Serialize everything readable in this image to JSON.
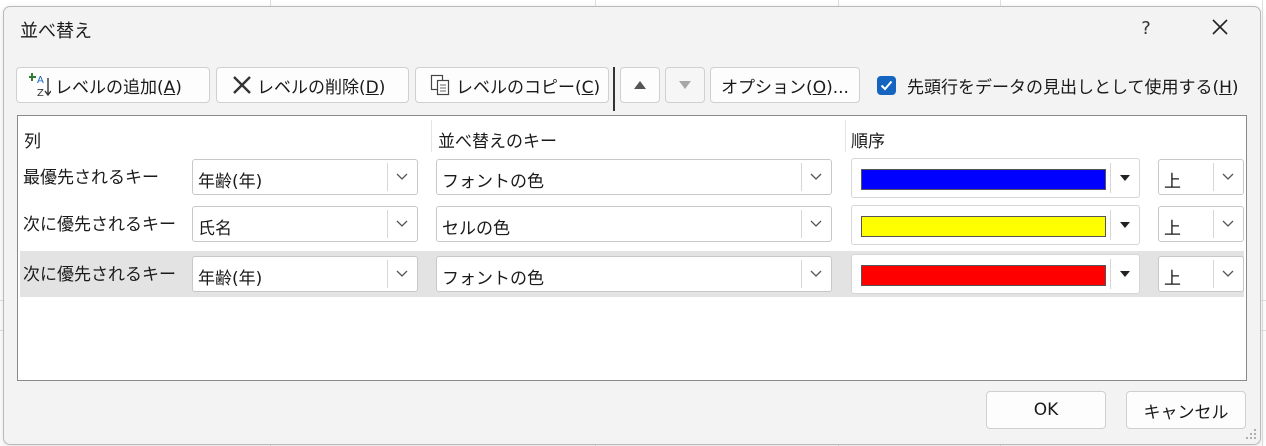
{
  "dialog": {
    "title": "並べ替え",
    "help_label": "?"
  },
  "toolbar": {
    "add_level": {
      "label": "レベルの追加(",
      "key": "A",
      "suffix": ")"
    },
    "delete_level": {
      "label": "レベルの削除(",
      "key": "D",
      "suffix": ")"
    },
    "copy_level": {
      "label": "レベルのコピー(",
      "key": "C",
      "suffix": ")"
    },
    "options": {
      "label": "オプション(",
      "key": "O",
      "suffix": ")..."
    },
    "header_checkbox": {
      "label": "先頭行をデータの見出しとして使用する(",
      "key": "H",
      "suffix": ")",
      "checked": true
    }
  },
  "columns": {
    "column": "列",
    "sort_on": "並べ替えのキー",
    "order": "順序"
  },
  "levels": [
    {
      "label": "最優先されるキー",
      "column": "年齢(年)",
      "sort_on": "フォントの色",
      "color": "#0000ff",
      "position": "上"
    },
    {
      "label": "次に優先されるキー",
      "column": "氏名",
      "sort_on": "セルの色",
      "color": "#ffff00",
      "position": "上"
    },
    {
      "label": "次に優先されるキー",
      "column": "年齢(年)",
      "sort_on": "フォントの色",
      "color": "#ff0000",
      "position": "上"
    }
  ],
  "selected_level": 2,
  "footer": {
    "ok": "OK",
    "cancel": "キャンセル"
  },
  "colors": {
    "accent": "#1565c0",
    "selection": "#e3e3e3"
  }
}
